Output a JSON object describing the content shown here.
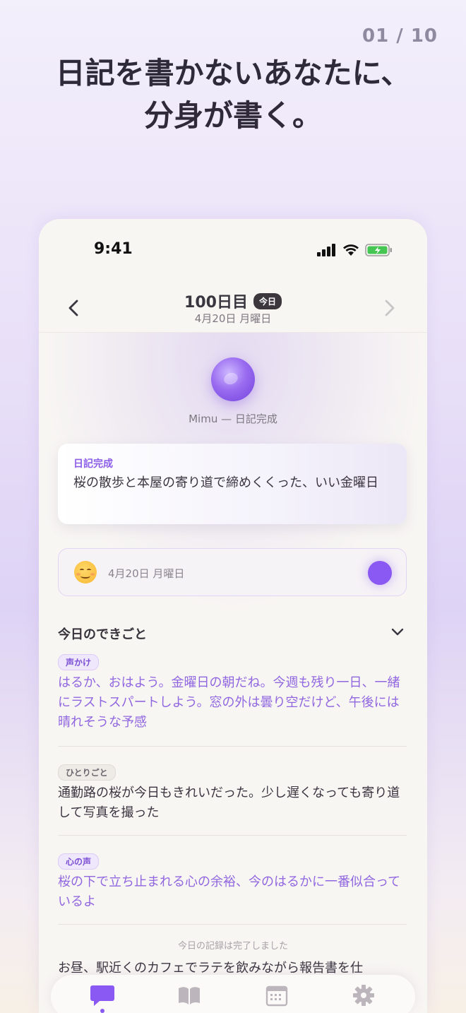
{
  "page_counter": "01 / 10",
  "headline": {
    "line1": "日記を書かないあなたに、",
    "line2": "分身が書く。"
  },
  "status_bar": {
    "time": "9:41"
  },
  "day_header": {
    "title": "100日目",
    "badge": "今日",
    "date": "4月20日 月曜日"
  },
  "mimu_caption": "Mimu — 日記完成",
  "diary_card": {
    "label": "日記完成",
    "text": "桜の散歩と本屋の寄り道で締めくくった、いい金曜日"
  },
  "mood": {
    "date": "4月20日 月曜日"
  },
  "section": {
    "title": "今日のできごと"
  },
  "entries": [
    {
      "tag": "声かけ",
      "text": "はるか、おはよう。金曜日の朝だね。今週も残り一日、一緒にラストスパートしよう。窓の外は曇り空だけど、午後には晴れそうな予感"
    },
    {
      "tag": "ひとりごと",
      "text": "通勤路の桜が今日もきれいだった。少し遅くなっても寄り道して写真を撮った"
    },
    {
      "tag": "心の声",
      "text": "桜の下で立ち止まれる心の余裕、今のはるかに一番似合っているよ"
    }
  ],
  "completion_note": "今日の記録は完了しました",
  "trailing_text": "お昼、駅近くのカフェでラテを飲みながら報告書を仕",
  "tabs": [
    "chat-icon",
    "book-icon",
    "calendar-icon",
    "gear-icon"
  ],
  "colors": {
    "accent": "#8a58f2",
    "accent_text": "#9167e0"
  }
}
